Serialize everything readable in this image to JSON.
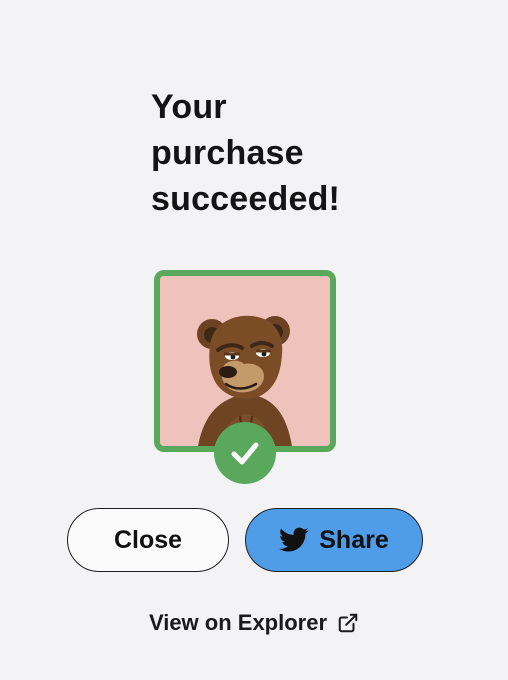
{
  "header": {
    "title_lines": [
      "Your",
      "purchase",
      "succeeded!"
    ]
  },
  "nft": {
    "image_icon": "bear-nft-icon",
    "status_icon": "check-icon",
    "frame_color": "#5aa85c",
    "background_color": "#efc3bc"
  },
  "actions": {
    "close_label": "Close",
    "share_label": "Share",
    "share_icon": "twitter-icon",
    "share_color": "#4f9ce9"
  },
  "explorer": {
    "label": "View on Explorer",
    "icon": "external-link-icon"
  }
}
